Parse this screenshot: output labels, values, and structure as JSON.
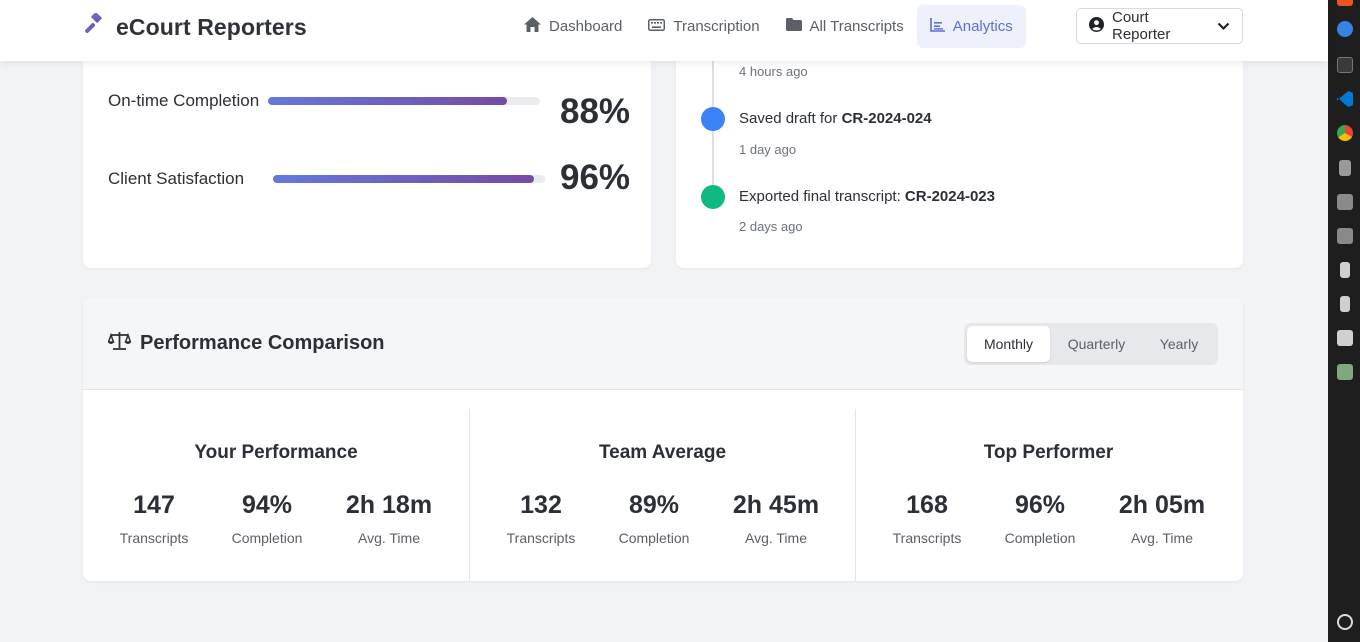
{
  "brand": {
    "name": "eCourt Reporters",
    "accent": "#5b6fd6"
  },
  "nav": {
    "items": [
      {
        "label": "Dashboard",
        "icon": "home-icon",
        "active": false
      },
      {
        "label": "Transcription",
        "icon": "keyboard-icon",
        "active": false
      },
      {
        "label": "All Transcripts",
        "icon": "folder-icon",
        "active": false
      },
      {
        "label": "Analytics",
        "icon": "chart-line-icon",
        "active": true
      }
    ],
    "user": {
      "label": "Court Reporter",
      "icon": "user-circle-icon"
    }
  },
  "metrics": [
    {
      "label": "On-time Completion",
      "value": "88%",
      "fraction": 0.88
    },
    {
      "label": "Client Satisfaction",
      "value": "96%",
      "fraction": 0.96
    }
  ],
  "activity": [
    {
      "time": "4 hours ago"
    },
    {
      "text": "Saved draft for ",
      "ref": "CR-2024-024",
      "time": "1 day ago",
      "color": "#3b82f6"
    },
    {
      "text": "Exported final transcript: ",
      "ref": "CR-2024-023",
      "time": "2 days ago",
      "color": "#10b981"
    }
  ],
  "performance": {
    "title": "Performance Comparison",
    "icon": "balance-scale-icon",
    "periods": [
      "Monthly",
      "Quarterly",
      "Yearly"
    ],
    "active_period": "Monthly",
    "columns": [
      {
        "title": "Your Performance",
        "stats": [
          {
            "value": "147",
            "label": "Transcripts"
          },
          {
            "value": "94%",
            "label": "Completion"
          },
          {
            "value": "2h 18m",
            "label": "Avg. Time"
          }
        ]
      },
      {
        "title": "Team Average",
        "stats": [
          {
            "value": "132",
            "label": "Transcripts"
          },
          {
            "value": "89%",
            "label": "Completion"
          },
          {
            "value": "2h 45m",
            "label": "Avg. Time"
          }
        ]
      },
      {
        "title": "Top Performer",
        "stats": [
          {
            "value": "168",
            "label": "Transcripts"
          },
          {
            "value": "96%",
            "label": "Completion"
          },
          {
            "value": "2h 05m",
            "label": "Avg. Time"
          }
        ]
      }
    ]
  },
  "dock": {
    "items": [
      "help-icon",
      "terminal-icon",
      "vscode-icon",
      "chrome-icon",
      "drive-icon",
      "disc-icon",
      "disc-icon",
      "device-icon",
      "device-icon",
      "camera-icon",
      "trash-icon"
    ],
    "bottom": "settings-icon"
  }
}
